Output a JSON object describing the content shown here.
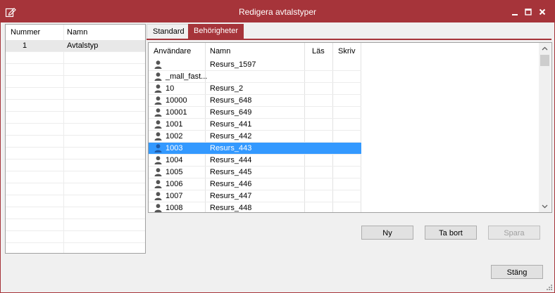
{
  "window": {
    "title": "Redigera avtalstyper",
    "accent_color": "#a6343a",
    "controls": {
      "minimize": "minimize-icon",
      "maximize": "maximize-icon",
      "close": "close-icon"
    }
  },
  "left_list": {
    "columns": [
      "Nummer",
      "Namn"
    ],
    "rows": [
      {
        "nummer": "1",
        "namn": "Avtalstyp"
      }
    ]
  },
  "tabs": [
    {
      "label": "Standard",
      "active": false
    },
    {
      "label": "Behörigheter",
      "active": true
    }
  ],
  "permissions_grid": {
    "columns": [
      "Användare",
      "Namn",
      "Läs",
      "Skriv"
    ],
    "rows": [
      {
        "user": "",
        "name": "Resurs_1597",
        "selected": false
      },
      {
        "user": "_mall_fast...",
        "name": "",
        "selected": false
      },
      {
        "user": "10",
        "name": "Resurs_2",
        "selected": false
      },
      {
        "user": "10000",
        "name": "Resurs_648",
        "selected": false
      },
      {
        "user": "10001",
        "name": "Resurs_649",
        "selected": false
      },
      {
        "user": "1001",
        "name": "Resurs_441",
        "selected": false
      },
      {
        "user": "1002",
        "name": "Resurs_442",
        "selected": false
      },
      {
        "user": "1003",
        "name": "Resurs_443",
        "selected": true
      },
      {
        "user": "1004",
        "name": "Resurs_444",
        "selected": false
      },
      {
        "user": "1005",
        "name": "Resurs_445",
        "selected": false
      },
      {
        "user": "1006",
        "name": "Resurs_446",
        "selected": false
      },
      {
        "user": "1007",
        "name": "Resurs_447",
        "selected": false
      },
      {
        "user": "1008",
        "name": "Resurs_448",
        "selected": false
      }
    ],
    "selection_color": "#3399ff"
  },
  "buttons": {
    "new": "Ny",
    "delete": "Ta bort",
    "save": "Spara",
    "close": "Stäng"
  }
}
